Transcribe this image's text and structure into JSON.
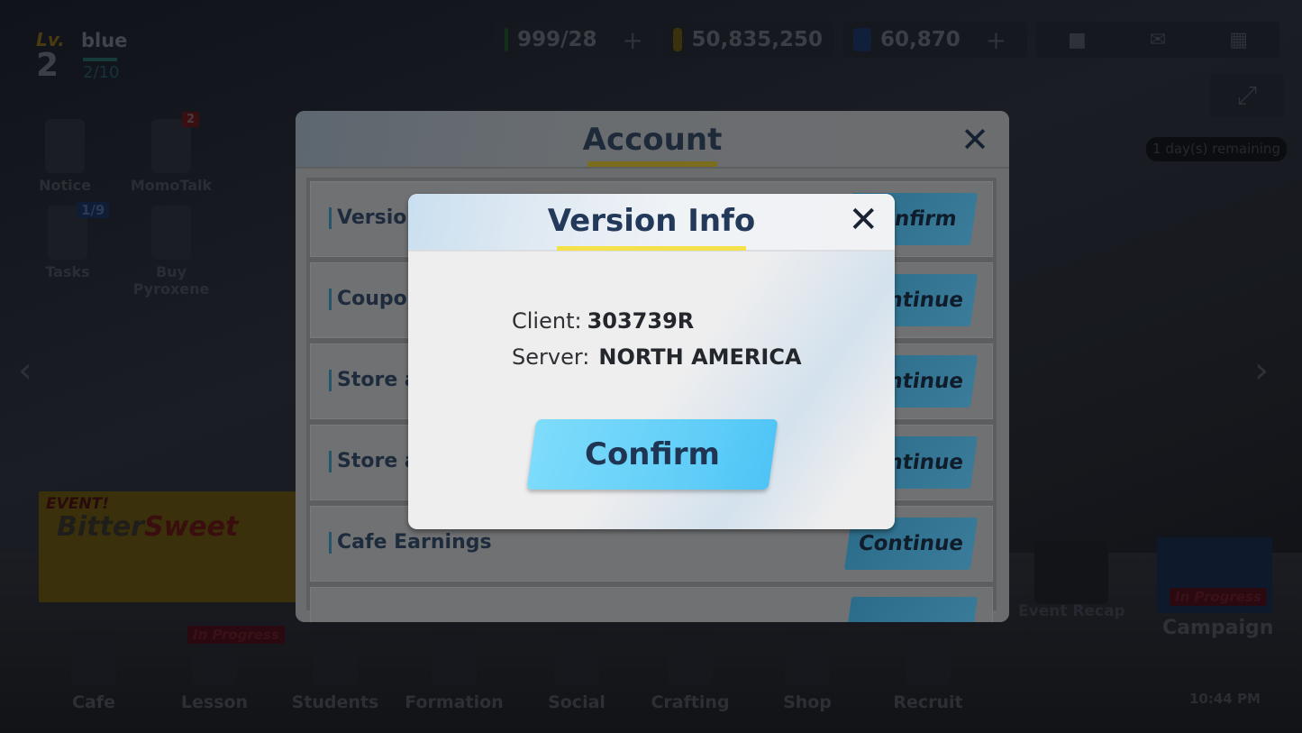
{
  "player": {
    "level_label": "Lv.",
    "level": "2",
    "name": "blue",
    "exp": "2/10"
  },
  "currencies": {
    "ap": "999/28",
    "credits": "50,835,250",
    "pyroxene": "60,870",
    "plus": "+"
  },
  "top_icons": [
    "profile-icon",
    "mail-icon",
    "menu-grid-icon"
  ],
  "remaining": "1 day(s) remaining",
  "shortcuts": [
    {
      "label": "Notice"
    },
    {
      "label": "MomoTalk",
      "badge": "2"
    },
    {
      "label": "Tasks",
      "badge": "1/9"
    },
    {
      "label": "Buy Pyroxene"
    }
  ],
  "event_banner": {
    "tag": "EVENT!",
    "title_a": "Bitter",
    "title_b": "Sweet"
  },
  "right_panel": {
    "event_recap": "Event Recap",
    "campaign": "Campaign",
    "in_progress": "In Progress"
  },
  "nav": [
    {
      "label": "Cafe"
    },
    {
      "label": "Lesson",
      "badge": "In Progress"
    },
    {
      "label": "Students"
    },
    {
      "label": "Formation"
    },
    {
      "label": "Social"
    },
    {
      "label": "Crafting"
    },
    {
      "label": "Shop"
    },
    {
      "label": "Recruit"
    }
  ],
  "time": "10:44 PM",
  "account": {
    "title": "Account",
    "rows": [
      {
        "label": "Version",
        "button": "Confirm"
      },
      {
        "label": "Coupon",
        "button": "Continue"
      },
      {
        "label": "Store a",
        "button": "Continue"
      },
      {
        "label": "Store a",
        "button": "Continue"
      },
      {
        "label": "Cafe Earnings",
        "button": "Continue"
      }
    ]
  },
  "version_info": {
    "title": "Version Info",
    "client_label": "Client:",
    "client_value": "303739R",
    "server_label": "Server:",
    "server_value": "NORTH AMERICA",
    "confirm": "Confirm"
  },
  "colors": {
    "title_underline": "#f5e14a",
    "confirm_button": "#6ad3f9",
    "title_text": "#22395a"
  }
}
